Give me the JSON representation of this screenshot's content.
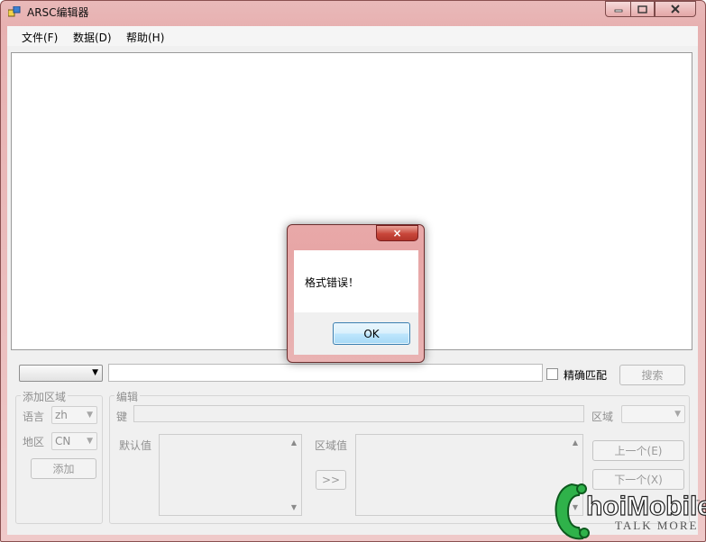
{
  "window": {
    "title": "ARSC编辑器"
  },
  "menu": {
    "items": [
      "文件(F)",
      "数据(D)",
      "帮助(H)"
    ]
  },
  "search": {
    "exact_label": "精确匹配",
    "button_label": "搜索"
  },
  "add_area": {
    "title": "添加区域",
    "language_label": "语言",
    "language_value": "zh",
    "region_label": "地区",
    "region_value": "CN",
    "add_button": "添加"
  },
  "edit": {
    "title": "编辑",
    "key_label": "键",
    "area_label": "区域",
    "default_label": "默认值",
    "area_value_label": "区域值",
    "copy_button": ">>",
    "prev_button": "上一个(E)",
    "next_button": "下一个(X)"
  },
  "dialog": {
    "message": "格式错误！",
    "ok_label": "OK",
    "close_glyph": "×"
  },
  "watermark": {
    "brand": "hoiMobile",
    "tagline": "TALK MORE",
    "tm": "™"
  }
}
